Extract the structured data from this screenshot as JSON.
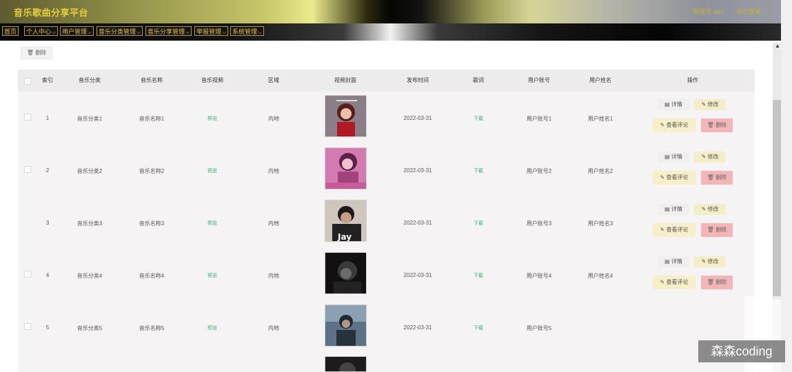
{
  "header": {
    "app_title": "音乐歌曲分享平台",
    "admin_info": "管理员 abo",
    "logout": "退出登录"
  },
  "nav": [
    {
      "label": "首页",
      "has_menu": false
    },
    {
      "label": "个人中心",
      "has_menu": true
    },
    {
      "label": "用户管理",
      "has_menu": true
    },
    {
      "label": "音乐分类管理",
      "has_menu": true
    },
    {
      "label": "音乐分享管理",
      "has_menu": true
    },
    {
      "label": "举报管理",
      "has_menu": true
    },
    {
      "label": "系统管理",
      "has_menu": true
    }
  ],
  "toolbar": {
    "delete_label": "删除"
  },
  "table": {
    "columns": [
      "索引",
      "音乐分类",
      "音乐名称",
      "音乐视频",
      "区域",
      "视频封面",
      "发布时间",
      "歌词",
      "用户账号",
      "用户姓名",
      "操作"
    ],
    "rows": [
      {
        "index": "1",
        "category": "音乐分类1",
        "name": "音乐名称1",
        "video": "预览",
        "region": "内地",
        "date": "2022-03-31",
        "lyrics": "下载",
        "account": "用户账号1",
        "username": "用户姓名1",
        "cover_text": ""
      },
      {
        "index": "2",
        "category": "音乐分类2",
        "name": "音乐名称2",
        "video": "预览",
        "region": "内地",
        "date": "2022-03-31",
        "lyrics": "下载",
        "account": "用户账号2",
        "username": "用户姓名2",
        "cover_text": ""
      },
      {
        "index": "3",
        "category": "音乐分类3",
        "name": "音乐名称3",
        "video": "预览",
        "region": "内地",
        "date": "2022-03-31",
        "lyrics": "下载",
        "account": "用户账号3",
        "username": "用户姓名3",
        "cover_text": "Jay"
      },
      {
        "index": "4",
        "category": "音乐分类4",
        "name": "音乐名称4",
        "video": "预览",
        "region": "内地",
        "date": "2022-03-31",
        "lyrics": "下载",
        "account": "用户账号4",
        "username": "用户姓名4",
        "cover_text": ""
      },
      {
        "index": "5",
        "category": "音乐分类5",
        "name": "音乐名称5",
        "video": "预览",
        "region": "内地",
        "date": "2022-03-31",
        "lyrics": "下载",
        "account": "用户账号5",
        "username": "",
        "cover_text": ""
      }
    ],
    "actions": {
      "detail": "详情",
      "edit": "修改",
      "view_comments": "查看评论",
      "delete": "删除"
    }
  },
  "watermark": "森森coding",
  "colors": {
    "accent_gold": "#e6cd3a",
    "link_green": "#2fb36b",
    "delete_red": "#f3b5b5",
    "edit_yellow": "#f3eec6"
  }
}
